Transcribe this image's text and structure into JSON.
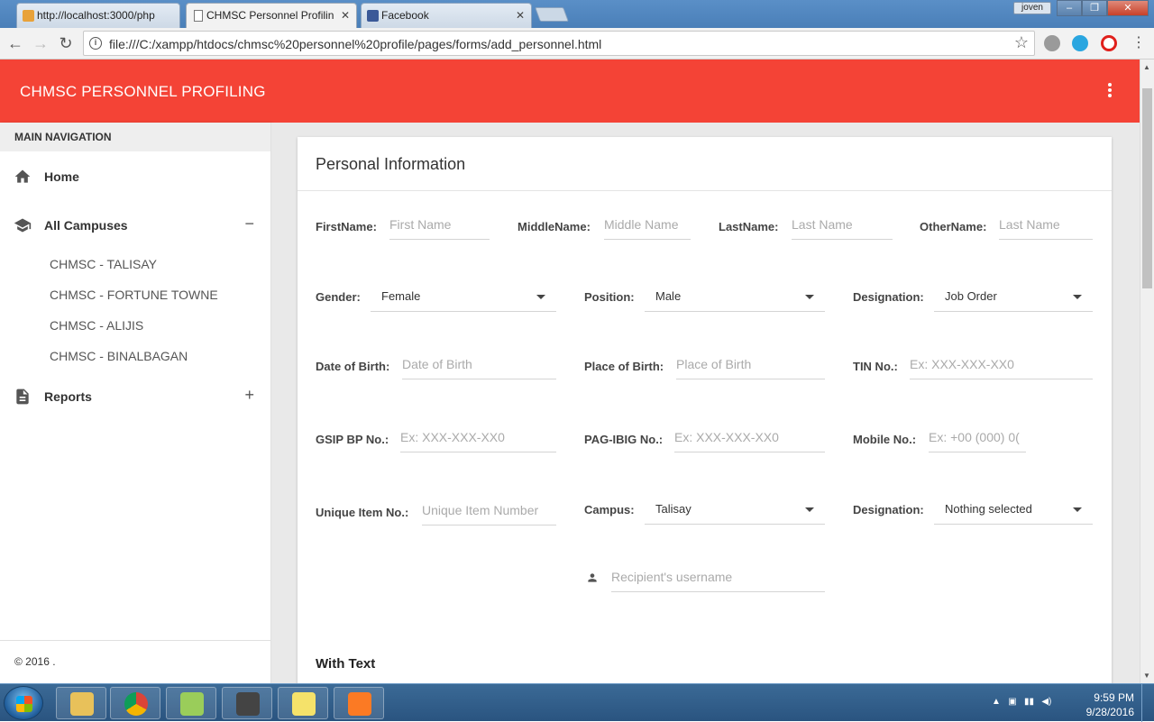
{
  "browser": {
    "tabs": [
      {
        "label": "http://localhost:3000/php",
        "active": false
      },
      {
        "label": "CHMSC Personnel Profilin",
        "active": true
      },
      {
        "label": "Facebook",
        "active": false
      }
    ],
    "user": "joven",
    "url": "file:///C:/xampp/htdocs/chmsc%20personnel%20profile/pages/forms/add_personnel.html"
  },
  "app": {
    "title": "CHMSC PERSONNEL PROFILING",
    "header_color": "#f44336"
  },
  "sidebar": {
    "header": "MAIN NAVIGATION",
    "items": [
      {
        "label": "Home",
        "icon": "home-icon"
      },
      {
        "label": "All Campuses",
        "icon": "graduation-cap-icon",
        "toggle": "−"
      },
      {
        "label": "Reports",
        "icon": "document-icon",
        "toggle": "+"
      }
    ],
    "campuses": [
      "CHMSC - TALISAY",
      "CHMSC - FORTUNE TOWNE",
      "CHMSC - ALIJIS",
      "CHMSC - BINALBAGAN"
    ],
    "footer": "© 2016 ."
  },
  "form": {
    "title": "Personal Information",
    "firstname": {
      "label": "FirstName:",
      "placeholder": "First Name"
    },
    "middlename": {
      "label": "MiddleName:",
      "placeholder": "Middle Name"
    },
    "lastname": {
      "label": "LastName:",
      "placeholder": "Last Name"
    },
    "othername": {
      "label": "OtherName:",
      "placeholder": "Last Name"
    },
    "gender": {
      "label": "Gender:",
      "value": "Female"
    },
    "position": {
      "label": "Position:",
      "value": "Male"
    },
    "designation1": {
      "label": "Designation:",
      "value": "Job Order"
    },
    "dob": {
      "label": "Date of Birth:",
      "placeholder": "Date of Birth"
    },
    "pob": {
      "label": "Place of Birth:",
      "placeholder": "Place of Birth"
    },
    "tin": {
      "label": "TIN No.:",
      "placeholder": "Ex: XXX-XXX-XX0"
    },
    "gsip": {
      "label": "GSIP BP No.:",
      "placeholder": "Ex: XXX-XXX-XX0"
    },
    "pagibig": {
      "label": "PAG-IBIG No.:",
      "placeholder": "Ex: XXX-XXX-XX0"
    },
    "mobile": {
      "label": "Mobile No.:",
      "placeholder": "Ex: +00 (000) 0("
    },
    "unique": {
      "label": "Unique Item No.:",
      "placeholder": "Unique Item Number"
    },
    "campus": {
      "label": "Campus:",
      "value": "Talisay"
    },
    "designation2": {
      "label": "Designation:",
      "value": "Nothing selected"
    },
    "username": {
      "placeholder": "Recipient's username"
    },
    "with_text": "With Text"
  },
  "taskbar": {
    "time": "9:59 PM",
    "date": "9/28/2016"
  }
}
